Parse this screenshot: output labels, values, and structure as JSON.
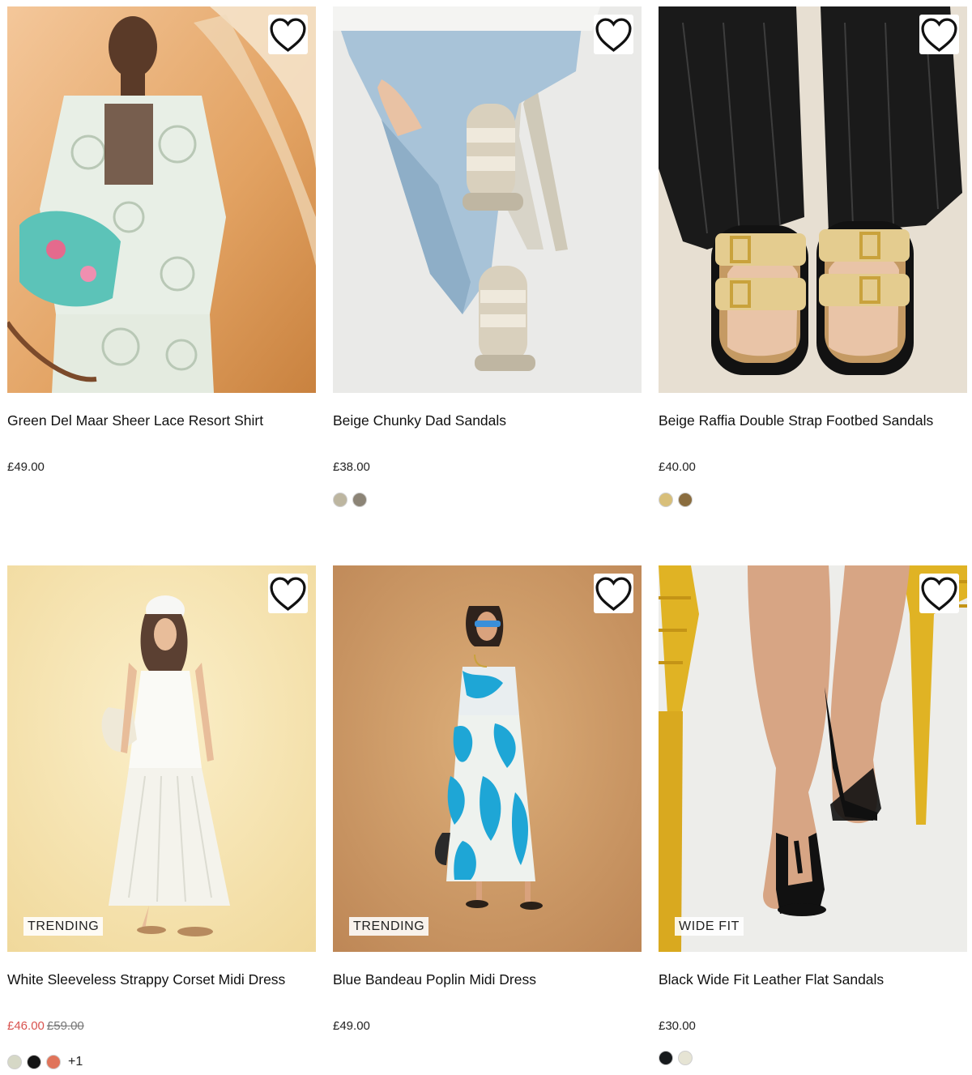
{
  "products": [
    {
      "name": "Green Del Maar Sheer Lace Resort Shirt",
      "price": "£49.00",
      "sale_price": "",
      "was_price": "",
      "badge": "",
      "swatches": [],
      "more_colours": ""
    },
    {
      "name": "Beige Chunky Dad Sandals",
      "price": "£38.00",
      "sale_price": "",
      "was_price": "",
      "badge": "",
      "swatches": [
        "#bdb6a0",
        "#8c8476"
      ],
      "more_colours": ""
    },
    {
      "name": "Beige Raffia Double Strap Footbed Sandals",
      "price": "£40.00",
      "sale_price": "",
      "was_price": "",
      "badge": "",
      "swatches": [
        "#d8bf7a",
        "#8a6d3f"
      ],
      "more_colours": ""
    },
    {
      "name": "White Sleeveless Strappy Corset Midi Dress",
      "price": "",
      "sale_price": "£46.00",
      "was_price": "£59.00",
      "badge": "TRENDING",
      "swatches": [
        "#d6d8c6",
        "#141414",
        "#e0745a"
      ],
      "more_colours": "+1"
    },
    {
      "name": "Blue Bandeau Poplin Midi Dress",
      "price": "£49.00",
      "sale_price": "",
      "was_price": "",
      "badge": "TRENDING",
      "swatches": [],
      "more_colours": ""
    },
    {
      "name": "Black Wide Fit Leather Flat Sandals",
      "price": "£30.00",
      "sale_price": "",
      "was_price": "",
      "badge": "WIDE FIT",
      "swatches": [
        "#171a1c",
        "#e6e4d4"
      ],
      "more_colours": ""
    }
  ],
  "icons": {
    "wishlist": "heart-outline-icon"
  },
  "colors": {
    "sale_price": "#d9534f",
    "text": "#111111"
  }
}
